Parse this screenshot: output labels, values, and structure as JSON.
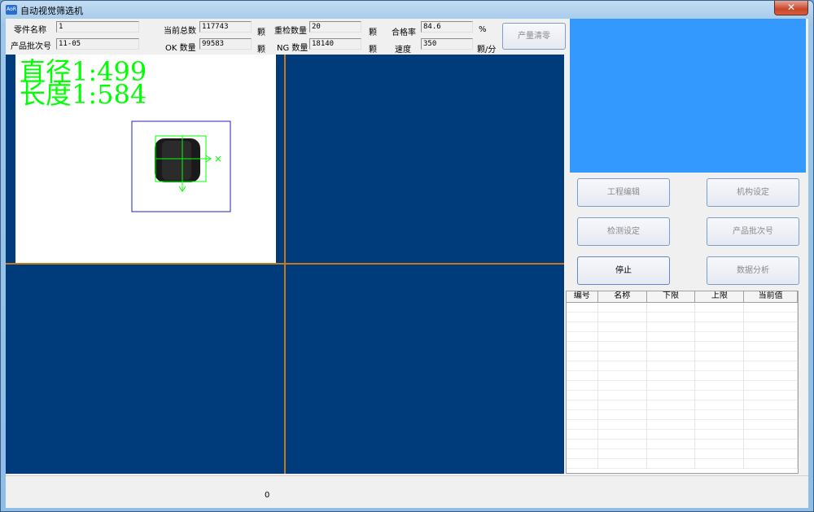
{
  "window": {
    "title": "自动视觉筛选机",
    "icon_text": "AoR",
    "close_glyph": "✕"
  },
  "info": {
    "part_name_label": "零件名称",
    "part_name_value": "1",
    "batch_label": "产品批次号",
    "batch_value": "11-05",
    "total_label": "当前总数",
    "total_value": "117743",
    "ok_label": "OK 数量",
    "ok_value": "99583",
    "unit_pcs": "颗",
    "recheck_label": "重检数量",
    "recheck_value": "20",
    "ng_label": "NG 数量",
    "ng_value": "18140",
    "yield_label": "合格率",
    "yield_value": "84.6",
    "yield_unit": "%",
    "speed_label": "速度",
    "speed_value": "350",
    "speed_unit": "颗/分",
    "clear_button": "产量清零"
  },
  "viewer": {
    "diameter_text": "直径1:499",
    "length_text": "长度1:584",
    "cross_glyph": "×",
    "accent": "#00ff00",
    "box_color": "#2020c0",
    "pane_color": "#003b7b",
    "divider_color": "#c47a1a"
  },
  "buttons": {
    "project_edit": "工程编辑",
    "mechanism_setup": "机构设定",
    "detect_setup": "检测设定",
    "batch_number": "产品批次号",
    "stop": "停止",
    "data_analysis": "数据分析"
  },
  "grid": {
    "columns": [
      "编号",
      "名称",
      "下限",
      "上限",
      "当前值"
    ]
  },
  "status": {
    "value": "0"
  },
  "colors": {
    "right_panel": "#3399ff"
  }
}
